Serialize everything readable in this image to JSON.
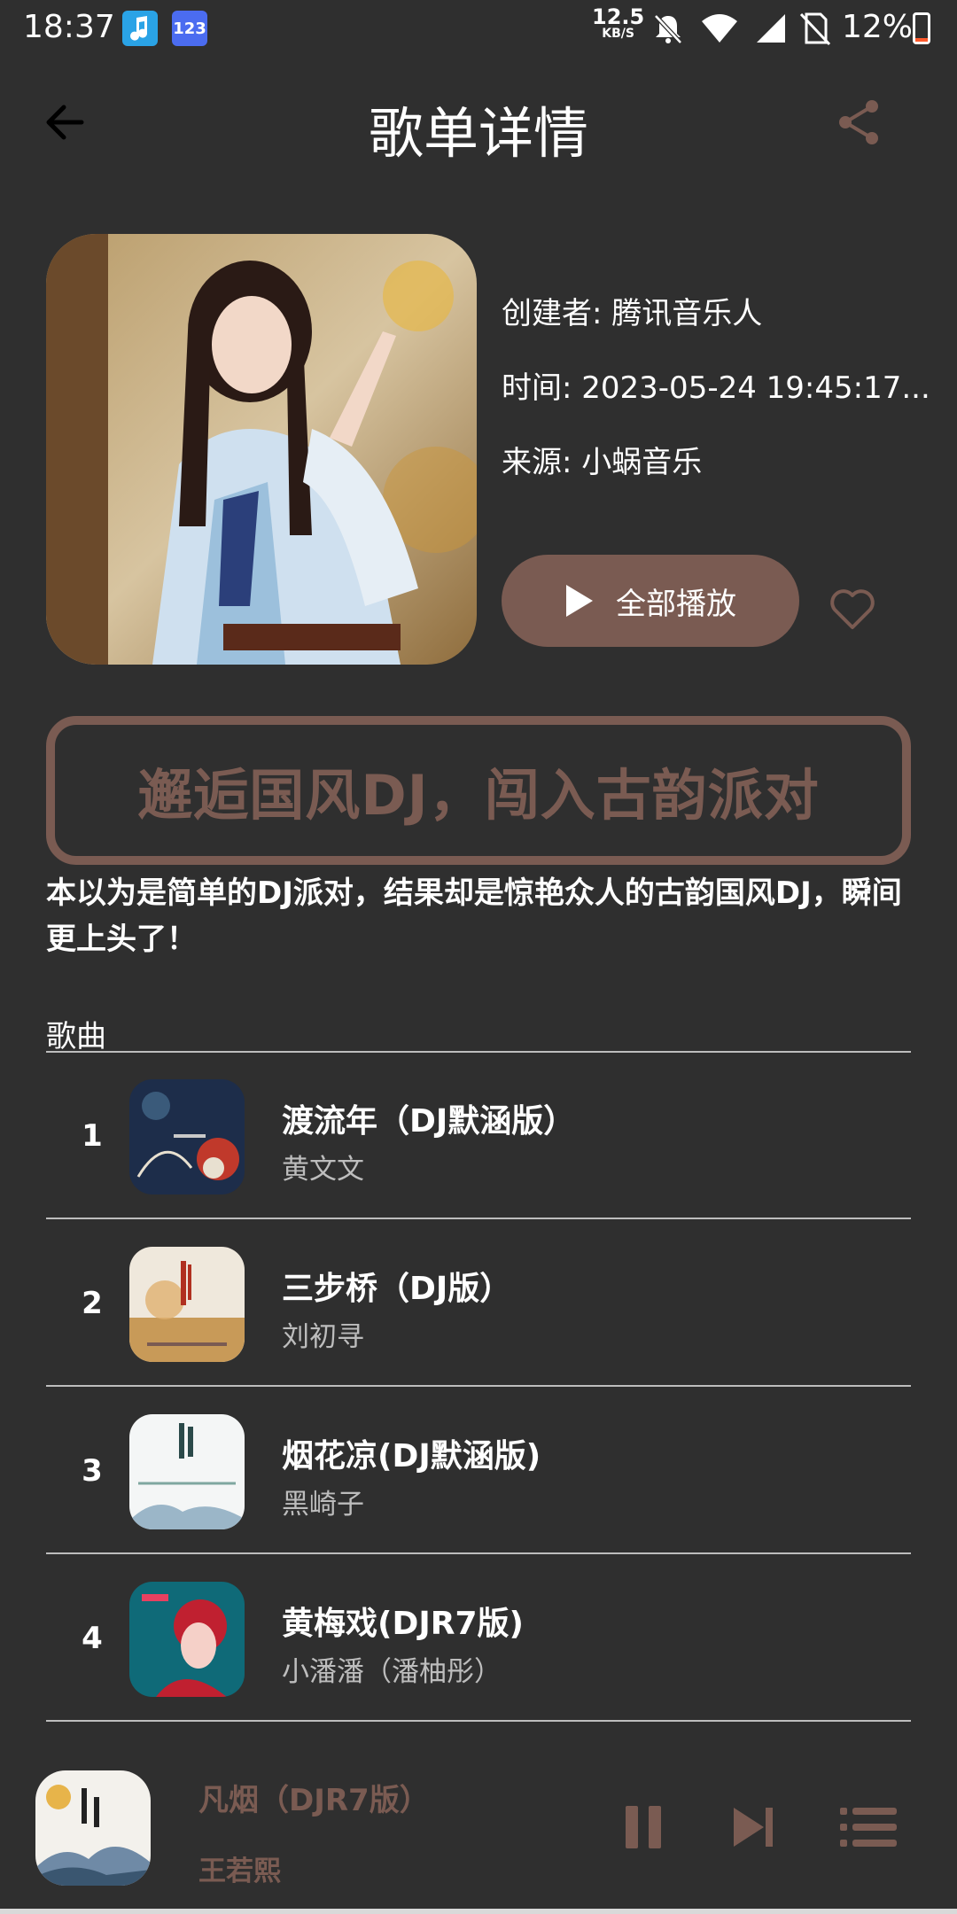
{
  "status_bar": {
    "time": "18:37",
    "app_icons": [
      "music-note-icon",
      "keyboard-123-icon"
    ],
    "app_123_label": "123",
    "net_speed": "12.5",
    "net_speed_unit": "KB/S",
    "battery_percent": "12%",
    "battery_level": 0.12,
    "battery_color": "#ff5a2c"
  },
  "header": {
    "title": "歌单详情"
  },
  "playlist": {
    "creator": "创建者: 腾讯音乐人",
    "time": "时间: 2023-05-24 19:45:17...",
    "source": "来源: 小蜗音乐",
    "play_all_label": "全部播放",
    "banner_text": "邂逅国风DJ，闯入古韵派对",
    "description": "本以为是简单的DJ派对，结果却是惊艳众人的古韵国风DJ，瞬间更上头了！"
  },
  "songs_section": {
    "label": "歌曲",
    "songs": [
      {
        "index": "1",
        "title": "渡流年（DJ默涵版）",
        "artist": "黄文文"
      },
      {
        "index": "2",
        "title": "三步桥（DJ版）",
        "artist": "刘初寻"
      },
      {
        "index": "3",
        "title": "烟花凉(DJ默涵版)",
        "artist": "黑崎子"
      },
      {
        "index": "4",
        "title": "黄梅戏(DJR7版)",
        "artist": "小潘潘（潘柚彤）"
      }
    ]
  },
  "mini_player": {
    "title": "凡烟（DJR7版）",
    "artist": "王若熙"
  },
  "colors": {
    "accent": "#7a5b52",
    "background": "#2f2f2f",
    "text_secondary": "#bdbdbd"
  }
}
